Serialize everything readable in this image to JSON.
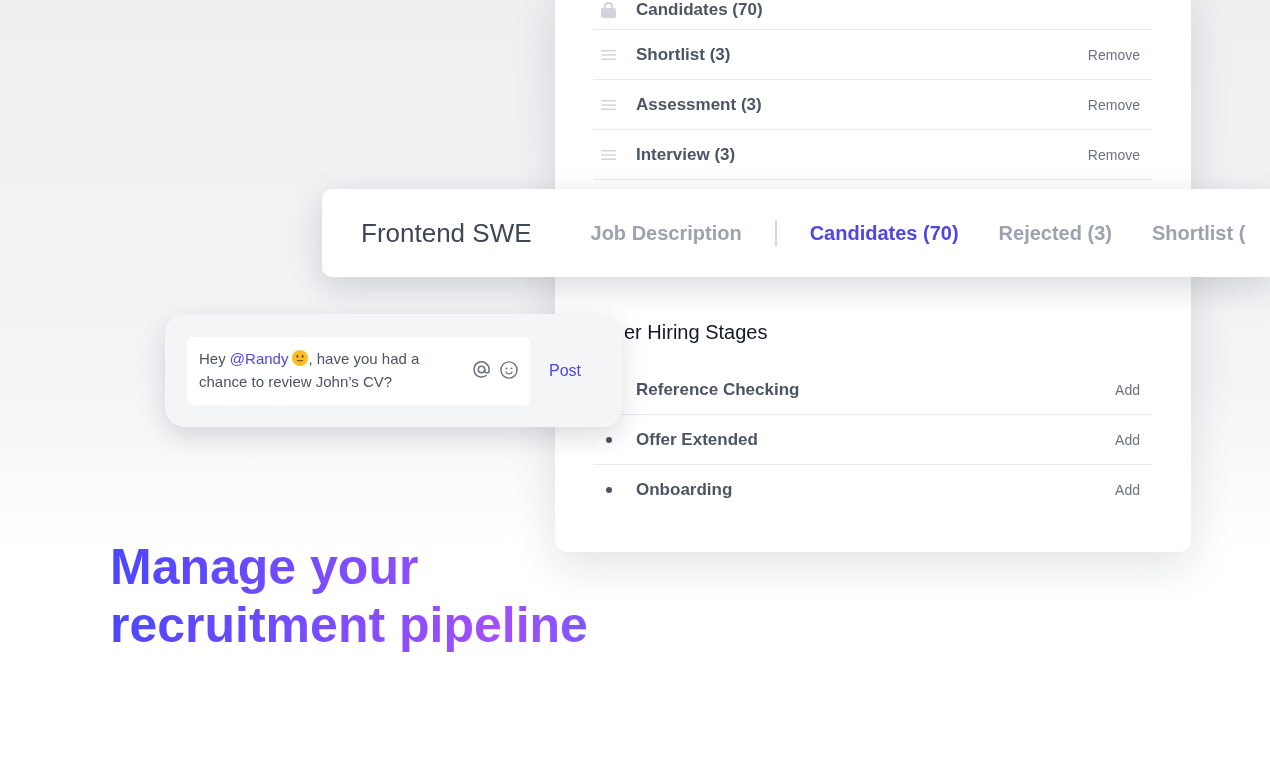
{
  "pipeline_card": {
    "stages": [
      {
        "kind": "locked",
        "label": "Candidates (70)"
      },
      {
        "kind": "movable",
        "label": "Shortlist (3)",
        "action": "Remove"
      },
      {
        "kind": "movable",
        "label": "Assessment (3)",
        "action": "Remove"
      },
      {
        "kind": "movable",
        "label": "Interview (3)",
        "action": "Remove"
      }
    ],
    "other_stages": {
      "title": "er Hiring Stages",
      "items": [
        {
          "label": "Reference Checking",
          "action": "Add",
          "bullet": false
        },
        {
          "label": "Offer Extended",
          "action": "Add",
          "bullet": true
        },
        {
          "label": "Onboarding",
          "action": "Add",
          "bullet": true
        }
      ]
    }
  },
  "job_header": {
    "title": "Frontend SWE",
    "tab_groups": [
      {
        "tabs": [
          {
            "label": "Job Description",
            "selected": false
          }
        ]
      },
      {
        "tabs": [
          {
            "label": "Candidates (70)",
            "selected": true
          },
          {
            "label": "Rejected (3)",
            "selected": false
          },
          {
            "label": "Shortlist (",
            "selected": false
          }
        ]
      }
    ]
  },
  "comment_box": {
    "parts": [
      {
        "kind": "text",
        "text": "Hey "
      },
      {
        "kind": "mention",
        "text": "@Randy"
      },
      {
        "kind": "emoji"
      },
      {
        "kind": "text",
        "text": ", have you had a chance to review John’s CV?"
      }
    ],
    "button": "Post"
  },
  "headline": "Manage your recruitment pipeline"
}
